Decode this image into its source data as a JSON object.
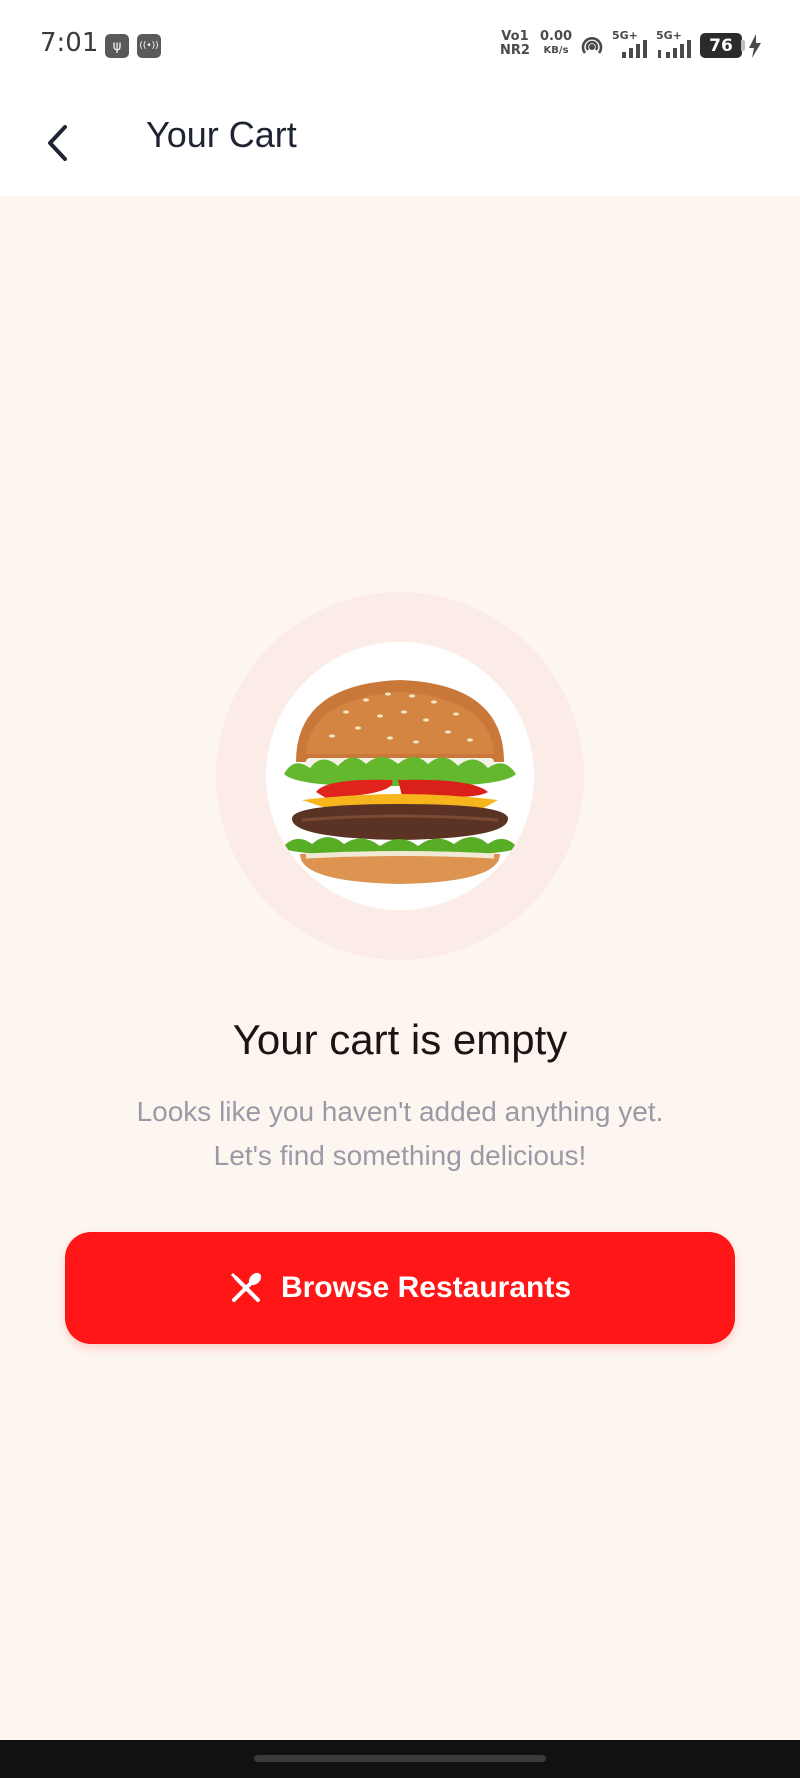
{
  "status_bar": {
    "time": "7:01",
    "usb_icon_glyph": "ψ",
    "hotspot_icon_glyph": "((•))",
    "volte_top": "Vo1",
    "volte_bottom": "NR2",
    "speed_value": "0.00",
    "speed_unit": "KB/s",
    "network_1": "5G+",
    "network_2": "5G+",
    "battery": "76"
  },
  "header": {
    "title": "Your Cart",
    "back_icon": "chevron-left-icon"
  },
  "empty_state": {
    "title": "Your cart is empty",
    "subtitle_line1": "Looks like you haven't added anything yet.",
    "subtitle_line2": "Let's find something delicious!",
    "button_label": "Browse Restaurants",
    "button_icon": "utensils-icon"
  },
  "colors": {
    "accent": "#ff1616",
    "background": "#fdf6f0",
    "halo": "#fbece7",
    "title_text": "#1e2433",
    "muted_text": "#9a9aa6"
  }
}
